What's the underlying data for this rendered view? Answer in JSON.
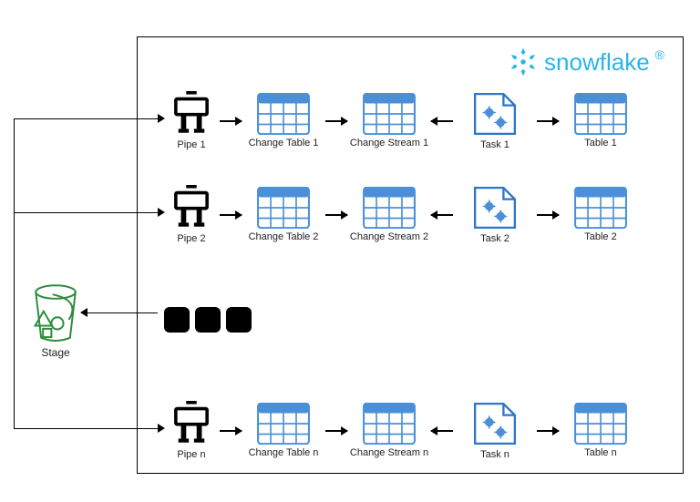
{
  "brand": {
    "name": "snowflake",
    "reg": "®",
    "color": "#29B5E8"
  },
  "stage": {
    "label": "Stage"
  },
  "rows": [
    {
      "pipe": "Pipe 1",
      "changeTable": "Change Table 1",
      "changeStream": "Change Stream 1",
      "task": "Task 1",
      "table": "Table 1"
    },
    {
      "pipe": "Pipe 2",
      "changeTable": "Change Table 2",
      "changeStream": "Change Stream 2",
      "task": "Task 2",
      "table": "Table 2"
    },
    {
      "pipe": "Pipe n",
      "changeTable": "Change Table n",
      "changeStream": "Change Stream n",
      "task": "Task n",
      "table": "Table n"
    }
  ],
  "ellipsis": "..."
}
